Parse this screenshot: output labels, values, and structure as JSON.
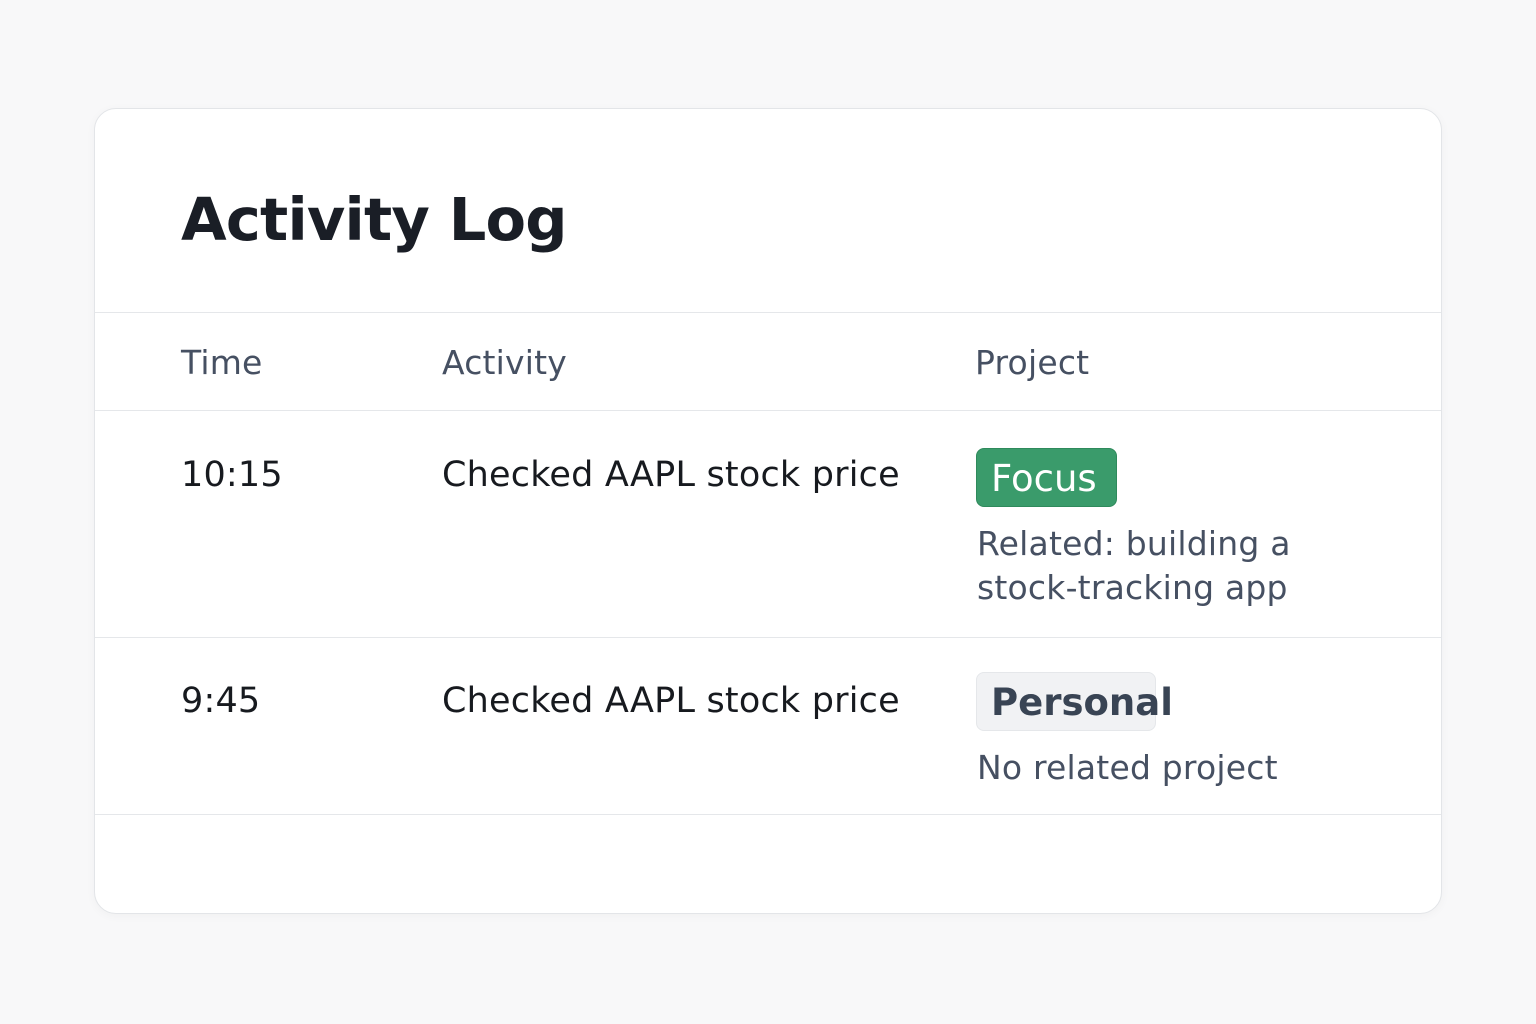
{
  "page": {
    "title": "Activity Log"
  },
  "table": {
    "columns": {
      "time": "Time",
      "activity": "Activity",
      "project": "Project"
    },
    "rows": [
      {
        "time": "10:15",
        "activity": "Checked AAPL stock price",
        "project_tag": "Focus",
        "project_note_lines": [
          "Related: building a",
          "stock-tracking app"
        ]
      },
      {
        "time": "9:45",
        "activity": "Checked AAPL stock price",
        "project_tag": "Personal",
        "project_note_lines": [
          "No related project"
        ]
      }
    ]
  },
  "colors": {
    "focus_badge": "#3a9b6b",
    "personal_badge": "#f1f2f4",
    "text_primary": "#171a1f",
    "text_secondary": "#465062"
  }
}
